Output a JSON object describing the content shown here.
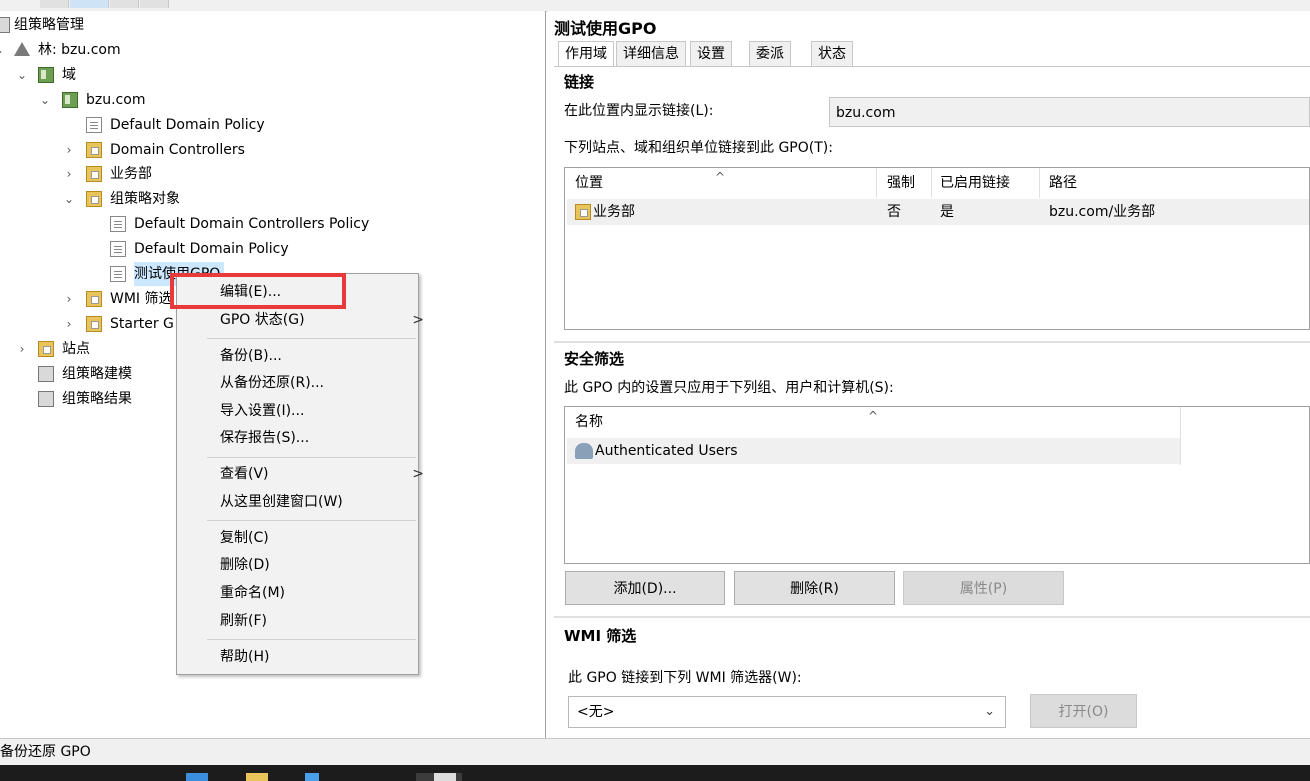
{
  "tree": {
    "root": "组策略管理",
    "forest": "林: bzu.com",
    "domains": "域",
    "domain": "bzu.com",
    "default_domain_policy_link": "Default Domain Policy",
    "domain_controllers": "Domain Controllers",
    "ou_business": "业务部",
    "gpo_container": "组策略对象",
    "gpo_ddcp": "Default Domain Controllers Policy",
    "gpo_ddp": "Default Domain Policy",
    "gpo_test": "测试使用GPO",
    "wmi_filters": "WMI 筛选",
    "starter_gpos": "Starter G",
    "sites": "站点",
    "modeling": "组策略建模",
    "results": "组策略结果"
  },
  "context_menu": {
    "items": [
      {
        "label": "编辑(E)...",
        "arrow": ""
      },
      {
        "label": "GPO 状态(G)",
        "arrow": ">"
      },
      {
        "label": "备份(B)..."
      },
      {
        "label": "从备份还原(R)..."
      },
      {
        "label": "导入设置(I)..."
      },
      {
        "label": "保存报告(S)..."
      },
      {
        "label": "查看(V)",
        "arrow": ">"
      },
      {
        "label": "从这里创建窗口(W)"
      },
      {
        "label": "复制(C)"
      },
      {
        "label": "删除(D)"
      },
      {
        "label": "重命名(M)"
      },
      {
        "label": "刷新(F)"
      },
      {
        "label": "帮助(H)"
      }
    ],
    "highlight_color": "#e83a3a"
  },
  "details": {
    "title": "测试使用GPO",
    "tabs": [
      "作用域",
      "详细信息",
      "设置",
      "委派",
      "状态"
    ],
    "links": {
      "heading": "链接",
      "display_label": "在此位置内显示链接(L):",
      "display_value": "bzu.com",
      "list_label": "下列站点、域和组织单位链接到此 GPO(T):",
      "columns": [
        "位置",
        "强制",
        "已启用链接",
        "路径"
      ],
      "rows": [
        {
          "location": "业务部",
          "enforced": "否",
          "enabled": "是",
          "path": "bzu.com/业务部"
        }
      ]
    },
    "security": {
      "heading": "安全筛选",
      "description": "此 GPO 内的设置只应用于下列组、用户和计算机(S):",
      "column": "名称",
      "rows": [
        "Authenticated Users"
      ],
      "buttons": {
        "add": "添加(D)...",
        "remove": "删除(R)",
        "properties": "属性(P)"
      }
    },
    "wmi": {
      "heading": "WMI 筛选",
      "description": "此 GPO 链接到下列 WMI 筛选器(W):",
      "selected": "<无>",
      "open_button": "打开(O)"
    }
  },
  "status_bar": "备份还原 GPO"
}
